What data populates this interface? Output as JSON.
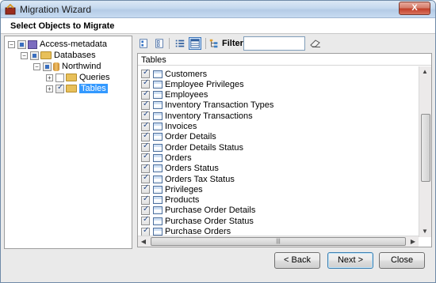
{
  "window": {
    "title": "Migration Wizard",
    "close_label": "X"
  },
  "header": {
    "heading": "Select Objects to Migrate"
  },
  "tree": {
    "root": "Access-metadata",
    "databases": "Databases",
    "database": "Northwind",
    "queries": "Queries",
    "tables": "Tables"
  },
  "toolbar": {
    "filter_label": "Filter:",
    "filter_value": ""
  },
  "list": {
    "header": "Tables",
    "items": [
      "Customers",
      "Employee Privileges",
      "Employees",
      "Inventory Transaction Types",
      "Inventory Transactions",
      "Invoices",
      "Order Details",
      "Order Details Status",
      "Orders",
      "Orders Status",
      "Orders Tax Status",
      "Privileges",
      "Products",
      "Purchase Order Details",
      "Purchase Order Status",
      "Purchase Orders"
    ]
  },
  "buttons": {
    "back": "< Back",
    "next": "Next >",
    "close": "Close"
  }
}
